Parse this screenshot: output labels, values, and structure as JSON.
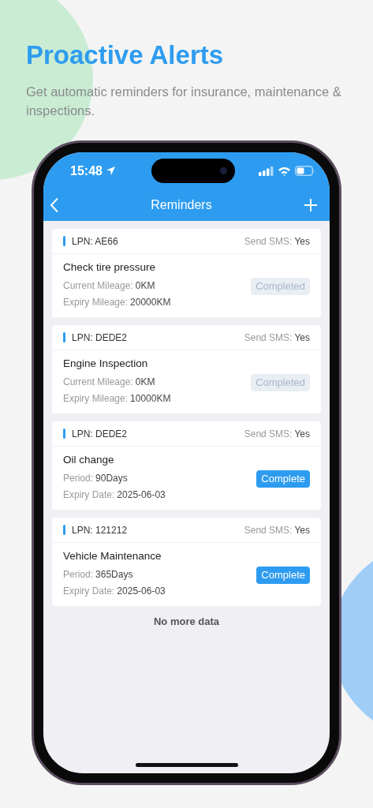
{
  "promo": {
    "title": "Proactive Alerts",
    "subtitle": "Get automatic reminders for insurance, maintenance & inspections."
  },
  "status_bar": {
    "time": "15:48"
  },
  "nav_bar": {
    "title": "Reminders"
  },
  "reminders": [
    {
      "lpn": "LPN: AE66",
      "sms_label": "Send SMS:",
      "sms": "Yes",
      "title": "Check tire pressure",
      "fields": [
        {
          "label": "Current Mileage:",
          "value": "0KM"
        },
        {
          "label": "Expiry Mileage:",
          "value": "20000KM"
        }
      ],
      "action": "Completed",
      "disabled": true
    },
    {
      "lpn": "LPN: DEDE2",
      "sms_label": "Send SMS:",
      "sms": "Yes",
      "title": "Engine Inspection",
      "fields": [
        {
          "label": "Current Mileage:",
          "value": "0KM"
        },
        {
          "label": "Expiry Mileage:",
          "value": "10000KM"
        }
      ],
      "action": "Completed",
      "disabled": true
    },
    {
      "lpn": "LPN: DEDE2",
      "sms_label": "Send SMS:",
      "sms": "Yes",
      "title": "Oil change",
      "fields": [
        {
          "label": "Period:",
          "value": "90Days"
        },
        {
          "label": "Expiry Date:",
          "value": "2025-06-03"
        }
      ],
      "action": "Complete",
      "disabled": false
    },
    {
      "lpn": "LPN: 121212",
      "sms_label": "Send SMS:",
      "sms": "Yes",
      "title": "Vehicle Maintenance",
      "fields": [
        {
          "label": "Period:",
          "value": "365Days"
        },
        {
          "label": "Expiry Date:",
          "value": "2025-06-03"
        }
      ],
      "action": "Complete",
      "disabled": false
    }
  ],
  "footer": "No more data"
}
